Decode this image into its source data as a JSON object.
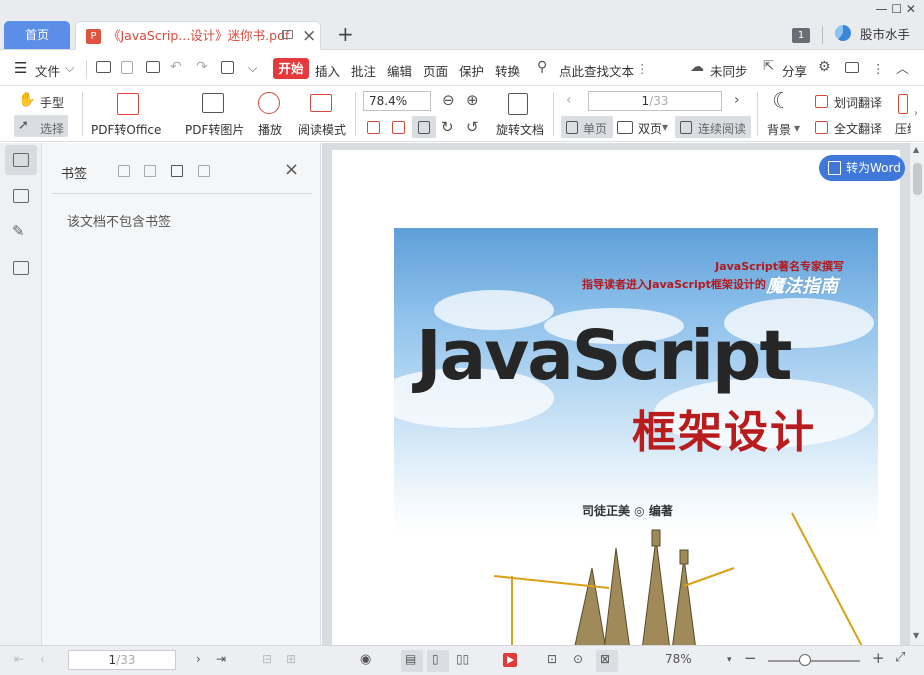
{
  "tabs": {
    "home": "首页",
    "doc_title": "《JavaScrip...设计》迷你书.pdf",
    "pdf_icon": "P"
  },
  "title_bar": {
    "badge": "1",
    "stock_label": "股市水手",
    "win_controls": "—  ☐  ✕"
  },
  "menu": {
    "file": "文件",
    "items": [
      "开始",
      "插入",
      "批注",
      "编辑",
      "页面",
      "保护",
      "转换"
    ],
    "search": "点此查找文本",
    "sync": "未同步",
    "share": "分享"
  },
  "ribbon": {
    "hand": "手型",
    "select": "选择",
    "pdf_to_office": "PDF转Office",
    "pdf_to_image": "PDF转图片",
    "play": "播放",
    "read_mode": "阅读模式",
    "zoom": "78.4%",
    "rotate": "旋转文档",
    "page_current": "1",
    "page_total": "/33",
    "single_page": "单页",
    "double_page": "双页",
    "continuous": "连续阅读",
    "background": "背景",
    "word_translate": "划词翻译",
    "full_translate": "全文翻译",
    "compress": "压缩"
  },
  "bookmark_panel": {
    "title": "书签",
    "empty": "该文档不包含书签"
  },
  "document": {
    "to_word": "转为Word",
    "cover": {
      "line1": "JavaScript著名专家撰写",
      "line2": "指导读者进入JavaScript框架设计的",
      "line2b": "魔法指南",
      "title_en": "JavaScript",
      "title_cn": "框架设计",
      "author": "司徒正美 ◎ 编著"
    }
  },
  "status_bar": {
    "page_current": "1",
    "page_total": "/33",
    "zoom": "78%"
  }
}
